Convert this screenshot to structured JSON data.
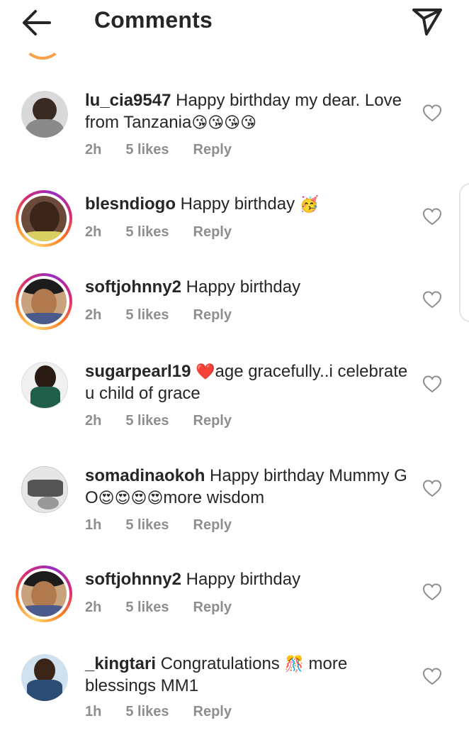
{
  "header": {
    "title": "Comments"
  },
  "comments": [
    {
      "username": "lu_cia9547",
      "text": " Happy birthday  my dear. Love from Tanzania",
      "emoji": "😘😘😘😘",
      "time": "2h",
      "likes": "5 likes",
      "reply": "Reply"
    },
    {
      "username": "blesndiogo",
      "text": " Happy birthday ",
      "emoji": "🥳",
      "time": "2h",
      "likes": "5 likes",
      "reply": "Reply"
    },
    {
      "username": "softjohnny2",
      "text": " Happy birthday",
      "emoji": "",
      "time": "2h",
      "likes": "5 likes",
      "reply": "Reply"
    },
    {
      "username": "sugarpearl19",
      "text_pre": " ",
      "emoji": "❤️",
      "text": "age gracefully..i celebrate u child of grace",
      "time": "2h",
      "likes": "5 likes",
      "reply": "Reply"
    },
    {
      "username": "somadinaokoh",
      "text": " Happy birthday Mummy G O",
      "emoji": "😍😍😍😍",
      "text_post": "more wisdom",
      "time": "1h",
      "likes": "5 likes",
      "reply": "Reply"
    },
    {
      "username": "softjohnny2",
      "text": " Happy birthday",
      "emoji": "",
      "time": "2h",
      "likes": "5 likes",
      "reply": "Reply"
    },
    {
      "username": "_kingtari",
      "text": " Congratulations ",
      "emoji": "🎊",
      "text_post": " more blessings MM1",
      "time": "1h",
      "likes": "5 likes",
      "reply": "Reply"
    }
  ],
  "colors": {
    "text": "#262626",
    "meta": "#8e8e8e",
    "heart_outline": "#8e8e8e",
    "story_ring_start": "#feda75",
    "story_ring_end": "#d62976"
  },
  "icons": {
    "back": "arrow-left-icon",
    "send": "paper-plane-icon",
    "like": "heart-outline-icon"
  }
}
